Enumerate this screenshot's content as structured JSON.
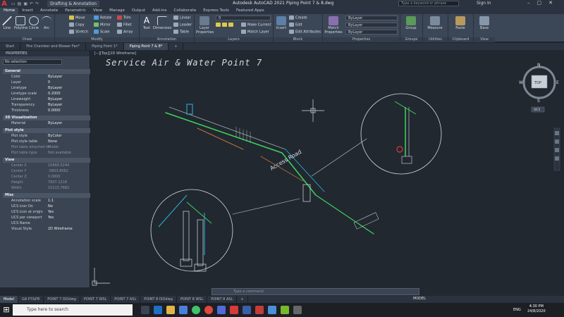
{
  "titlebar": {
    "workspace": "Drafting & Annotation",
    "app_title": "Autodesk AutoCAD 2021   Piping Point 7 & 8.dwg",
    "search_placeholder": "Type a keyword or phrase",
    "sign_in": "Sign In"
  },
  "ribbon_tabs": [
    "Home",
    "Insert",
    "Annotate",
    "Parametric",
    "View",
    "Manage",
    "Output",
    "Add-ins",
    "Collaborate",
    "Express Tools",
    "Featured Apps"
  ],
  "ribbon": {
    "draw": {
      "title": "Draw",
      "line": "Line",
      "polyline": "Polyline",
      "circle": "Circle",
      "arc": "Arc"
    },
    "modify": {
      "title": "Modify",
      "move": "Move",
      "rotate": "Rotate",
      "trim": "Trim",
      "copy": "Copy",
      "mirror": "Mirror",
      "fillet": "Fillet",
      "stretch": "Stretch",
      "scale": "Scale",
      "array": "Array"
    },
    "annotation": {
      "title": "Annotation",
      "text": "Text",
      "dimension": "Dimension",
      "linear": "Linear",
      "leader": "Leader",
      "table": "Table"
    },
    "layers": {
      "title": "Layers",
      "layer_properties": "Layer Properties",
      "current_layer": "0",
      "make_current": "Make Current",
      "match_layer": "Match Layer"
    },
    "block": {
      "title": "Block",
      "insert": "Insert",
      "create": "Create",
      "edit": "Edit",
      "edit_attributes": "Edit Attributes"
    },
    "properties": {
      "title": "Properties",
      "match_properties": "Match Properties",
      "color": "ByLayer",
      "linetype": "ByLayer",
      "lineweight": "ByLayer"
    },
    "groups": {
      "title": "Groups",
      "group": "Group"
    },
    "utilities": {
      "title": "Utilities",
      "measure": "Measure"
    },
    "clipboard": {
      "title": "Clipboard",
      "paste": "Paste"
    },
    "view": {
      "title": "View",
      "base": "Base"
    }
  },
  "file_tabs": [
    "Start",
    "Fire Chamber and Blower Fan*",
    "Piping Point 1*",
    "Piping Point 7 & 8*"
  ],
  "properties_palette": {
    "title": "PROPERTIES",
    "selection": "No selection",
    "sections": [
      {
        "name": "General",
        "rows": [
          [
            "Color",
            "ByLayer"
          ],
          [
            "Layer",
            "0"
          ],
          [
            "Linetype",
            "ByLayer"
          ],
          [
            "Linetype scale",
            "0.2000"
          ],
          [
            "Lineweight",
            "ByLayer"
          ],
          [
            "Transparency",
            "ByLayer"
          ],
          [
            "Thickness",
            "0.0000"
          ]
        ]
      },
      {
        "name": "3D Visualization",
        "rows": [
          [
            "Material",
            "ByLayer"
          ]
        ]
      },
      {
        "name": "Plot style",
        "rows": [
          [
            "Plot style",
            "ByColor"
          ],
          [
            "Plot style table",
            "None"
          ],
          [
            "Plot table attached to",
            "Model"
          ],
          [
            "Plot table type",
            "Not available"
          ]
        ]
      },
      {
        "name": "View",
        "rows": [
          [
            "Center X",
            "10666.5244"
          ],
          [
            "Center Y",
            "-3803.8062"
          ],
          [
            "Center Z",
            "0.0000"
          ],
          [
            "Height",
            "7907.1218"
          ],
          [
            "Width",
            "15115.7662"
          ]
        ]
      },
      {
        "name": "Misc",
        "rows": [
          [
            "Annotation scale",
            "1:1"
          ],
          [
            "UCS icon On",
            "No"
          ],
          [
            "UCS icon at origin",
            "Yes"
          ],
          [
            "UCS per viewport",
            "Yes"
          ],
          [
            "UCS Name",
            ""
          ],
          [
            "Visual Style",
            "2D Wireframe"
          ]
        ]
      }
    ]
  },
  "canvas": {
    "view_label": "[−][Top][2D Wireframe]",
    "drawing_title": "Service Air & Water Point 7",
    "labels": [
      "Access Road"
    ],
    "viewcube": {
      "top": "TOP",
      "n": "N",
      "s": "S",
      "e": "E",
      "w": "W",
      "wcs": "WCS"
    }
  },
  "command_line": {
    "placeholder": "Type a command"
  },
  "layout_tabs": [
    "Model",
    "GA P7&P8",
    "POINT 7 ISOdwg",
    "POINT 7 WSL",
    "POINT 7 ASL",
    "POINT 8 ISOdwg",
    "POINT 8 WSL",
    "POINT 8 ASL"
  ],
  "status": {
    "model": "MODEL"
  },
  "taskbar": {
    "search_placeholder": "Type here to search",
    "lang": "ENG",
    "time": "4:30 PM",
    "date": "24/8/2020"
  },
  "colors": {
    "accent_green": "#3fd45a",
    "cyan": "#2fb5d9",
    "bg": "#212830",
    "ribbon": "#3b4656"
  }
}
